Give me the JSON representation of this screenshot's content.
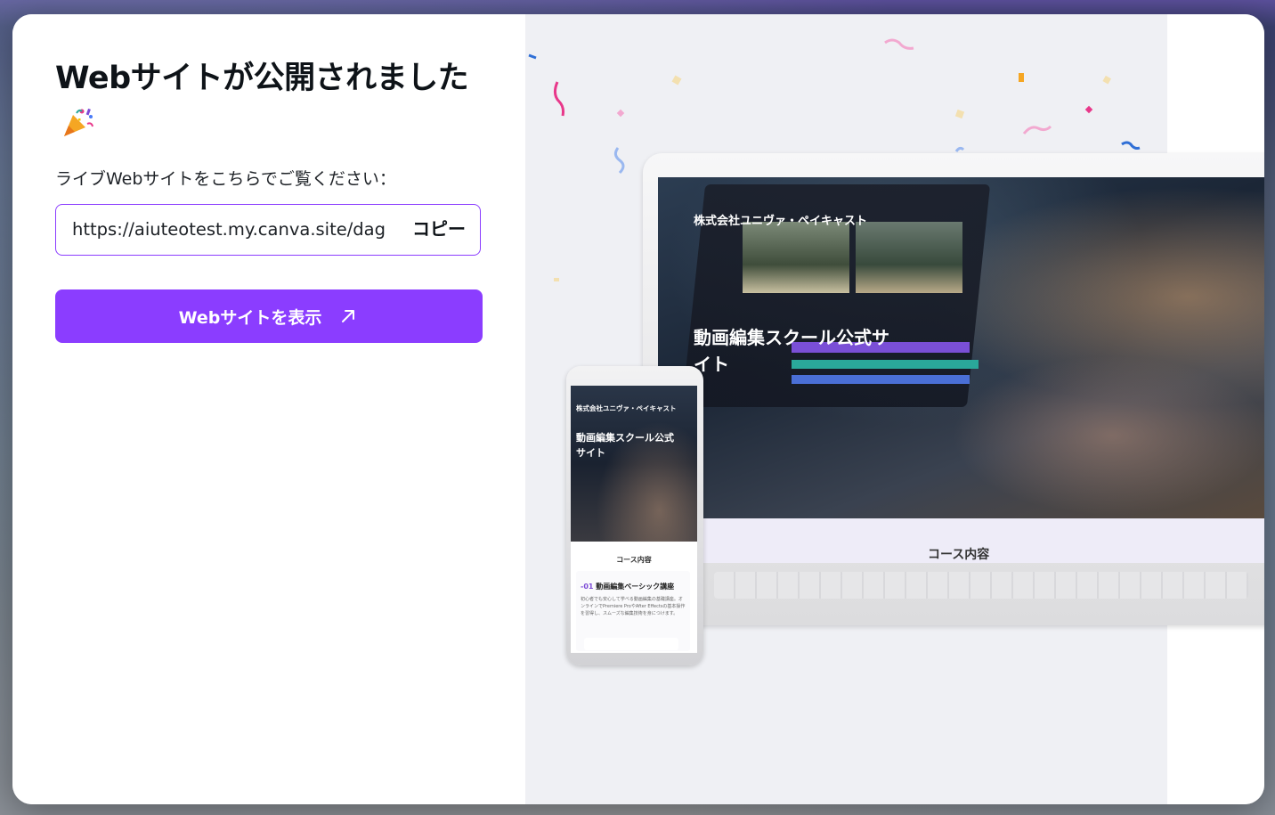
{
  "dialog": {
    "title": "Webサイトが公開されました",
    "party_icon": "party-popper-icon",
    "subtitle": "ライブWebサイトをこちらでご覧ください：",
    "url_value": "https://aiuteotest.my.canva.site/dag",
    "copy_label": "コピー",
    "view_label": "Webサイトを表示",
    "view_icon": "external-link-arrow-icon"
  },
  "preview": {
    "company": "株式会社ユニヴァ・ペイキャスト",
    "headline": "動画編集スクール公式サイト",
    "course_heading": "コース内容",
    "card_number": "-01",
    "card_title": "動画編集ベーシック講座",
    "card_body": "初心者でも安心して学べる動画編集の基礎講座。オンラインでPremiere ProやAfter Effectsの基本操作を習得し、スムーズな編集技術を身につけます。"
  },
  "colors": {
    "accent": "#8b3dff",
    "preview_bg": "#eff0f4"
  }
}
